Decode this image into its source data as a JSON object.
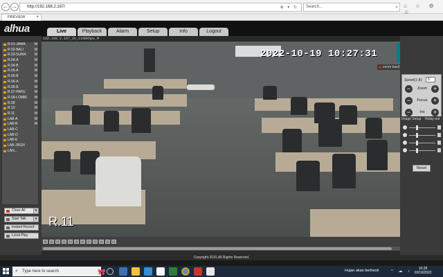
{
  "browser": {
    "url": "http://192.168.2.167/",
    "search_placeholder": "Search...",
    "tab_title": "PREVIEW",
    "nav_back": "←",
    "nav_forward": "→",
    "addr_tools": "⊕ ▾ ↻",
    "toolbar_icons": "⌂ ☆ ⚙ ☺"
  },
  "app": {
    "brand": "alhua",
    "menu": [
      "Live",
      "Playback",
      "Alarm",
      "Setup",
      "Info",
      "Logout"
    ],
    "active_menu": "Live"
  },
  "cameras": [
    {
      "label": "R.01-JAWA",
      "flag": "M"
    },
    {
      "label": "R.02-BALI",
      "flag": "M"
    },
    {
      "label": "R.03-SUMA",
      "flag": "M"
    },
    {
      "label": "R.04-A",
      "flag": "M"
    },
    {
      "label": "R.04-B",
      "flag": "M"
    },
    {
      "label": "R.05-A",
      "flag": "M"
    },
    {
      "label": "R.05-B",
      "flag": "M"
    },
    {
      "label": "R.06-A",
      "flag": "M"
    },
    {
      "label": "R.06-B",
      "flag": "M"
    },
    {
      "label": "R.07-PAPU",
      "flag": "M"
    },
    {
      "label": "R.08-LOMBI",
      "flag": "M"
    },
    {
      "label": "R.09",
      "flag": "M"
    },
    {
      "label": "R.10",
      "flag": "M"
    },
    {
      "label": "R.11",
      "flag": "M"
    },
    {
      "label": "LAB-A",
      "flag": "M"
    },
    {
      "label": "LAB-B",
      "flag": "M"
    },
    {
      "label": "LAB-C",
      "flag": ""
    },
    {
      "label": "LAB-D",
      "flag": ""
    },
    {
      "label": "LAB-E",
      "flag": ""
    },
    {
      "label": "LAB-JRGN",
      "flag": ""
    },
    {
      "label": "LAN...",
      "flag": ""
    }
  ],
  "actions": {
    "close_all": "Close All",
    "start_talk": "Start Talk",
    "instant_record": "Instant Record",
    "local_play": "Local Play"
  },
  "video": {
    "info_line": "192.168.2.167_1h_1180kbps_M",
    "timestamp": "2022-10-19  10:27:31",
    "camera_label": "R.11"
  },
  "zoom": {
    "avatar_letter": "Z",
    "label": "zoom bas04"
  },
  "ptz": {
    "speed_label": "Speed(1-8):",
    "speed_value": "5",
    "rows": [
      {
        "label": "Zoom",
        "minus": "−",
        "plus": "+"
      },
      {
        "label": "Focus",
        "minus": "−",
        "plus": "+"
      },
      {
        "label": "Iris",
        "minus": "−",
        "plus": "+"
      }
    ]
  },
  "image_setup": {
    "tab1": "Image Setup",
    "tab2": "Relay-out",
    "reset": "Reset",
    "sliders": [
      {
        "name": "brightness",
        "level": 0.25
      },
      {
        "name": "contrast",
        "level": 0.25
      },
      {
        "name": "saturation",
        "level": 0.25
      },
      {
        "name": "hue",
        "level": 0.25
      }
    ]
  },
  "footer": {
    "copyright": "Copyright 2015,All Rights Reserved."
  },
  "taskbar": {
    "search_placeholder": "Type here to search",
    "weather": "Hujan akan berhenti",
    "time": "10:28",
    "date": "10/19/2022",
    "search_icon": "⌕",
    "ribbon_icon": "🎀",
    "tray_icons": "^ ☁ ♪"
  },
  "colors": {
    "header_bg": "#111111",
    "accent_orange": "#e8a000",
    "zoom_tile": "#0d7c87",
    "taskbar": "#1d2a3a"
  }
}
